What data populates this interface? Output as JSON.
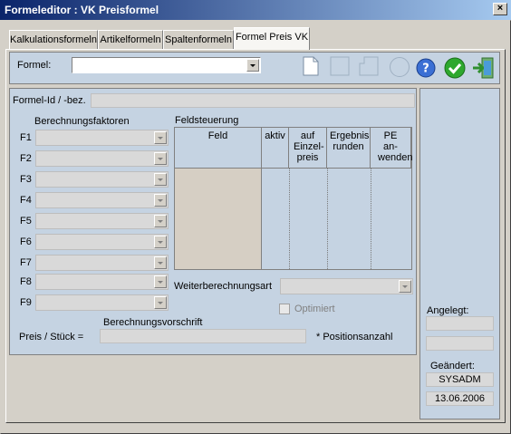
{
  "window": {
    "title": "Formeleditor : VK Preisformel",
    "close_label": "×"
  },
  "tabs": [
    "Kalkulationsformeln",
    "Artikelformeln",
    "Spaltenformeln",
    "Formel Preis VK"
  ],
  "toolbar": {
    "formel_label": "Formel:",
    "formel_value": ""
  },
  "form": {
    "formel_id_label": "Formel-Id / -bez.",
    "berechnungsfaktoren_label": "Berechnungsfaktoren",
    "factors": [
      "F1",
      "F2",
      "F3",
      "F4",
      "F5",
      "F6",
      "F7",
      "F8",
      "F9"
    ],
    "feldsteuerung_label": "Feldsteuerung",
    "grid_headers": [
      "Feld",
      "aktiv",
      "auf Einzel-preis",
      "Ergebnis runden",
      "PE an-wenden"
    ],
    "weiterberechnungsart_label": "Weiterberechnungsart",
    "optimiert_label": "Optimiert",
    "berechnungsvorschrift_label": "Berechnungsvorschrift",
    "preis_stueck_label": "Preis / Stück =",
    "positionsanzahl_label": "* Positionsanzahl"
  },
  "side": {
    "angelegt_label": "Angelegt:",
    "geaendert_label": "Geändert:",
    "geaendert_user": "SYSADM",
    "geaendert_date": "13.06.2006"
  },
  "colors": {
    "pane": "#c5d3e2",
    "titlebar": "#0a246a",
    "field": "#d9d9d9"
  }
}
